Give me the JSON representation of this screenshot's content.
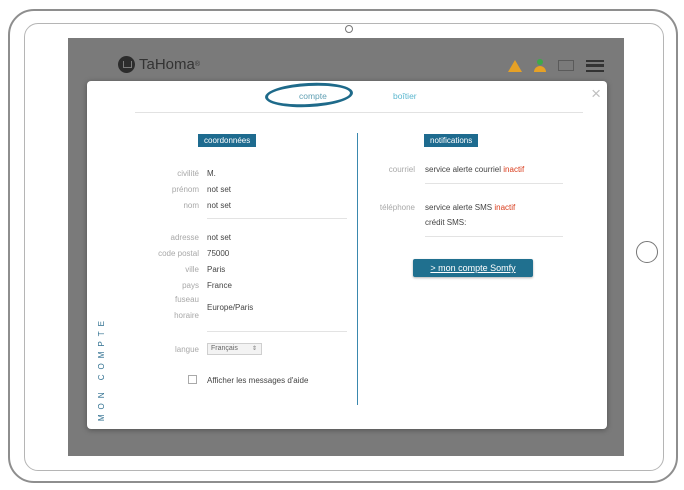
{
  "app": {
    "logo_text": "TaHoma",
    "logo_mark": "®"
  },
  "colors": {
    "accent": "#1e6b8f",
    "tab_link": "#5bb7cf",
    "inactive": "#d93c1c",
    "warning": "#e6a126"
  },
  "modal": {
    "close_label": "×",
    "tabs": [
      {
        "label": "compte"
      },
      {
        "label": "boîtier"
      }
    ],
    "side_title": "MON COMPTE"
  },
  "coordonnees": {
    "title": "coordonnées",
    "civilite": {
      "label": "civilité",
      "value": "M."
    },
    "prenom": {
      "label": "prénom",
      "value": "not set"
    },
    "nom": {
      "label": "nom",
      "value": "not set"
    },
    "adresse": {
      "label": "adresse",
      "value": "not set"
    },
    "code_postal": {
      "label": "code postal",
      "value": "75000"
    },
    "ville": {
      "label": "ville",
      "value": "Paris"
    },
    "pays": {
      "label": "pays",
      "value": "France"
    },
    "fuseau": {
      "label_1": "fuseau",
      "label_2": "horaire",
      "value": "Europe/Paris"
    },
    "langue": {
      "label": "langue",
      "value": "Français",
      "arrow": "⇕"
    },
    "help_checkbox": {
      "label": "Afficher les messages d'aide",
      "checked": false
    }
  },
  "notifications": {
    "title": "notifications",
    "courriel": {
      "label": "courriel",
      "text": "service alerte courriel",
      "status": "inactif"
    },
    "telephone": {
      "label": "téléphone",
      "text": "service alerte SMS",
      "status": "inactif",
      "credit": "crédit SMS:"
    },
    "somfy_button": "> mon compte Somfy"
  }
}
